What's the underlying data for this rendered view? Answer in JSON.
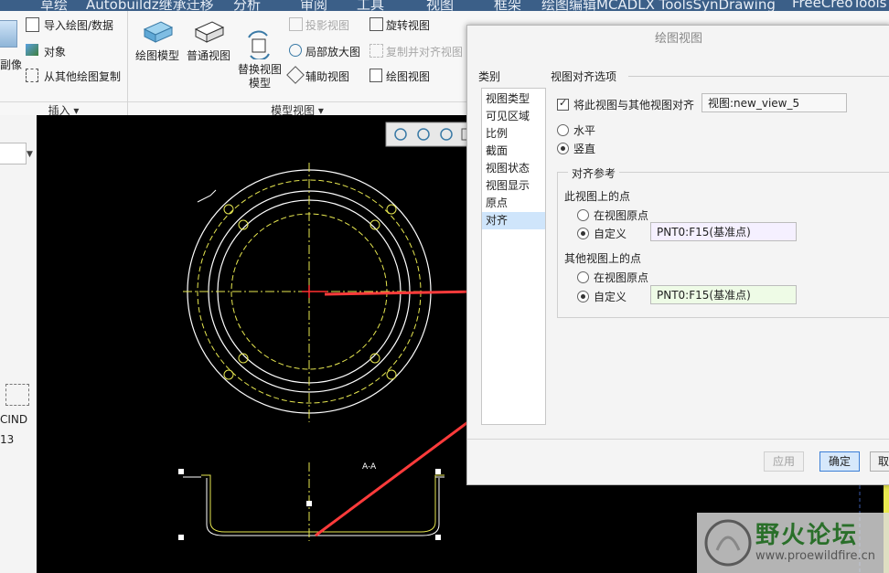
{
  "tabs": [
    "草绘",
    "Autobuildz继承迁移",
    "分析",
    "审阅",
    "工具",
    "视图",
    "框架",
    "绘图编辑MCADLX ToolsSynDrawing",
    "FreeCreoTools"
  ],
  "ribbon": {
    "insert_group": {
      "partial_left": "副像",
      "items": [
        "导入绘图/数据",
        "对象",
        "从其他绘图复制"
      ],
      "footer": "插入 ▾"
    },
    "model_views_group": {
      "big_buttons": [
        "绘图模型",
        "普通视图",
        "替换视图\n模型"
      ],
      "small_col1": [
        "投影视图",
        "局部放大图",
        "辅助视图"
      ],
      "small_col2": [
        "旋转视图",
        "复制并对齐视图",
        "绘图视图"
      ],
      "footer": "模型视图 ▾"
    }
  },
  "left_panel": {
    "label1": "CIND",
    "label2": "13"
  },
  "dialog": {
    "title": "绘图视图",
    "categories_header": "类别",
    "categories": [
      "视图类型",
      "可见区域",
      "比例",
      "截面",
      "视图状态",
      "视图显示",
      "原点",
      "对齐"
    ],
    "selected_category": "对齐",
    "align_section_title": "视图对齐选项",
    "align_checkbox_label": "将此视图与其他视图对齐",
    "align_checked": true,
    "align_view_value": "视图:new_view_5",
    "orientation": {
      "horizontal": "水平",
      "vertical": "竖直",
      "selected": "竖直"
    },
    "ref_section_title": "对齐参考",
    "this_view_title": "此视图上的点",
    "this_view_origin": "在视图原点",
    "this_view_custom": "自定义",
    "this_view_value": "PNT0:F15(基准点)",
    "other_view_title": "其他视图上的点",
    "other_view_origin": "在视图原点",
    "other_view_custom": "自定义",
    "other_view_value": "PNT0:F15(基准点)",
    "apply_label": "应用",
    "ok_label": "确定",
    "cancel_partial": "取",
    "colors": {
      "this_view_box": "#f5f0ff",
      "other_view_box": "#eefbe6",
      "ok_bg": "#d6e8fb"
    }
  },
  "drawing": {
    "section_label": "A-A",
    "arrow_color": "#ff3b3b",
    "line_color": "#ffffff",
    "dash_color": "#e8e850"
  },
  "watermark": {
    "name": "野火论坛",
    "url": "www.proewildfire.cn"
  }
}
